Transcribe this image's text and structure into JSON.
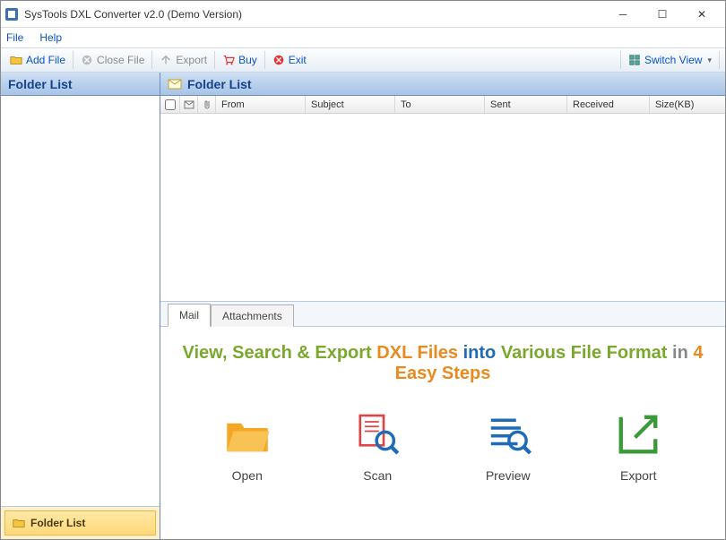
{
  "window": {
    "title": "SysTools DXL Converter v2.0 (Demo Version)"
  },
  "menu": {
    "file": "File",
    "help": "Help"
  },
  "toolbar": {
    "add_file": "Add File",
    "close_file": "Close File",
    "export": "Export",
    "buy": "Buy",
    "exit": "Exit",
    "switch_view": "Switch View"
  },
  "sidebar": {
    "header": "Folder List",
    "footer_label": "Folder List"
  },
  "main": {
    "header": "Folder List",
    "columns": {
      "from": "From",
      "subject": "Subject",
      "to": "To",
      "sent": "Sent",
      "received": "Received",
      "size": "Size(KB)"
    },
    "tabs": {
      "mail": "Mail",
      "attachments": "Attachments"
    }
  },
  "promo": {
    "p1": "View, Search & Export",
    "p2": "DXL Files",
    "p3": "into",
    "p4": "Various File Format",
    "p5": "in",
    "p6": "4 Easy Steps",
    "steps": {
      "open": "Open",
      "scan": "Scan",
      "preview": "Preview",
      "export": "Export"
    }
  }
}
